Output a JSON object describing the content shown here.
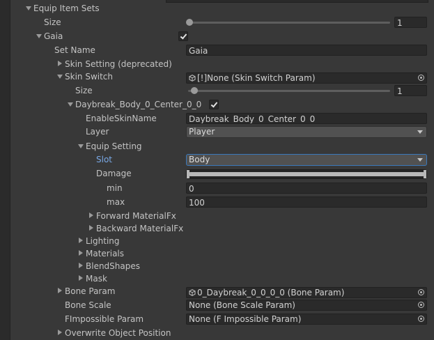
{
  "inspector": {
    "equip_item_sets": "Equip Item Sets",
    "size_label": "Size",
    "size_value": "1",
    "gaia_label": "Gaia",
    "set_name_label": "Set Name",
    "set_name_value": "Gaia",
    "skin_setting_label": "Skin Setting (deprecated)",
    "skin_switch_label": "Skin Switch",
    "skin_switch_value": "[!]None (Skin Switch Param)",
    "inner_size_label": "Size",
    "inner_size_value": "1",
    "daybreak_label": "Daybreak_Body_0_Center_0_0",
    "enable_skin_name_label": "EnableSkinName",
    "enable_skin_name_value": "Daybreak_Body_0_Center_0_0",
    "layer_label": "Layer",
    "layer_value": "Player",
    "equip_setting_label": "Equip Setting",
    "slot_label": "Slot",
    "slot_value": "Body",
    "damage_label": "Damage",
    "min_label": "min",
    "min_value": "0",
    "max_label": "max",
    "max_value": "100",
    "forward_materialfx_label": "Forward MaterialFx",
    "backward_materialfx_label": "Backward MaterialFx",
    "lighting_label": "Lighting",
    "materials_label": "Materials",
    "blendshapes_label": "BlendShapes",
    "mask_label": "Mask",
    "bone_param_label": "Bone Param",
    "bone_param_value": "0_Daybreak_0_0_0_0 (Bone Param)",
    "bone_scale_label": "Bone Scale",
    "bone_scale_value": "None (Bone Scale Param)",
    "fimpossible_param_label": "FImpossible Param",
    "fimpossible_param_value": "None (F Impossible Param)",
    "overwrite_object_position_label": "Overwrite Object Position"
  },
  "colors": {
    "background": "#383838",
    "field": "#2a2a2a",
    "accent": "#3a79bb",
    "focused_label": "#7aa9e6"
  },
  "icons": {
    "foldout_open": "triangle-down",
    "foldout_closed": "triangle-right",
    "object_picker": "target-circle",
    "scriptable_object": "scriptable-object-icon"
  }
}
